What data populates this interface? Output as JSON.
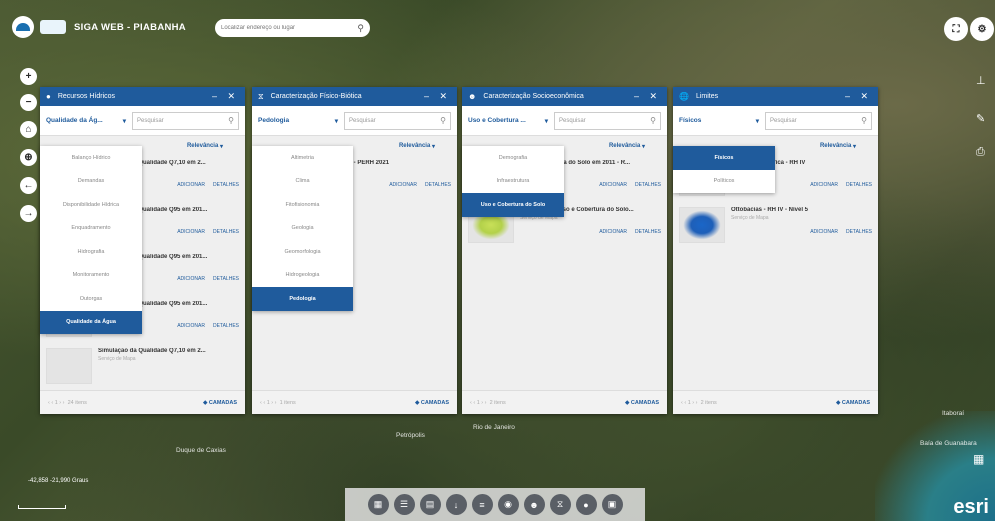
{
  "caption": "Limites.",
  "app": {
    "title": "SIGA WEB - PIABANHA",
    "search_placeholder": "Localizar endereço ou lugar"
  },
  "map": {
    "coordinates": "-42,858 -21,990 Graus",
    "labels": [
      "Petrópolis",
      "Rio de Janeiro",
      "Duque de Caxias",
      "Itaboraí",
      "Baía de Guanabara"
    ],
    "attribution": "esri"
  },
  "left_tools": [
    "plus-icon",
    "minus-icon",
    "home-icon",
    "target-icon",
    "back-icon",
    "forward-icon"
  ],
  "panels": [
    {
      "title": "Recursos Hídricos",
      "select": "Qualidade da Ág...",
      "search_placeholder": "Pesquisar",
      "sort": "Relevância",
      "dropdown": [
        "Balanço Hídrico",
        "Demandas",
        "Disponibilidade Hídrica",
        "Enquadramento",
        "Hidrografia",
        "Monitoramento",
        "Outorgas",
        "Qualidade da Água"
      ],
      "selected": "Qualidade da Água",
      "items": [
        {
          "title": "Simulação da Qualidade Q7,10 em 2...",
          "sub": "Serviço de Mapa"
        },
        {
          "title": "Simulação da Qualidade Q95 em 201...",
          "sub": "Serviço de Mapa"
        },
        {
          "title": "Simulação da Qualidade Q95 em 201...",
          "sub": "Serviço de Mapa"
        },
        {
          "title": "Simulação da Qualidade Q95 em 201...",
          "sub": "Serviço de Mapa"
        },
        {
          "title": "Simulação da Qualidade Q7,10 em 2...",
          "sub": "Serviço de Mapa"
        }
      ],
      "count": "24 itens",
      "layers": "CAMADAS"
    },
    {
      "title": "Caracterização Físico-Biótica",
      "select": "Pedologia",
      "search_placeholder": "Pesquisar",
      "sort": "Relevância",
      "dropdown": [
        "Altimetria",
        "Clima",
        "Fitofisionomia",
        "Geologia",
        "Geomorfologia",
        "Hidrogeologia",
        "Pedologia"
      ],
      "selected": "Pedologia",
      "items": [
        {
          "title": "Mapa de Solos - PERH 2021",
          "sub": "Serviço de Mapa"
        }
      ],
      "count": "1 itens",
      "layers": "CAMADAS"
    },
    {
      "title": "Caracterização Socioeconômica",
      "select": "Uso e Cobertura ...",
      "search_placeholder": "Pesquisar",
      "sort": "Relevância",
      "dropdown": [
        "Demografia",
        "Infraestrutura",
        "Uso e Cobertura do Solo"
      ],
      "selected": "Uso e Cobertura do Solo",
      "items": [
        {
          "title": "Uso e Cobertura do Solo em 2011 - R...",
          "sub": "Serviço de Mapa"
        },
        {
          "title": "Mapbiomas - Uso e Cobertura do Solo...",
          "sub": "Serviço de Mapa"
        }
      ],
      "count": "2 itens",
      "layers": "CAMADAS"
    },
    {
      "title": "Limites",
      "select": "Físicos",
      "search_placeholder": "Pesquisar",
      "sort": "Relevância",
      "dropdown": [
        "Físicos",
        "Políticos"
      ],
      "selected": "Físicos",
      "items": [
        {
          "title": "Bacia Hidrográfica - RH IV",
          "sub": "Serviço de Mapa"
        },
        {
          "title": "Ottobacias - RH IV - Nível 5",
          "sub": "Serviço de Mapa"
        }
      ],
      "count": "2 itens",
      "layers": "CAMADAS"
    }
  ],
  "item_actions": {
    "add": "ADICIONAR",
    "details": "DETALHES"
  },
  "bottom_toolbar": [
    "grid-icon",
    "layers-icon",
    "table-icon",
    "download-icon",
    "list-icon",
    "globe-icon",
    "users-icon",
    "hourglass-icon",
    "drop-icon",
    "document-icon"
  ]
}
